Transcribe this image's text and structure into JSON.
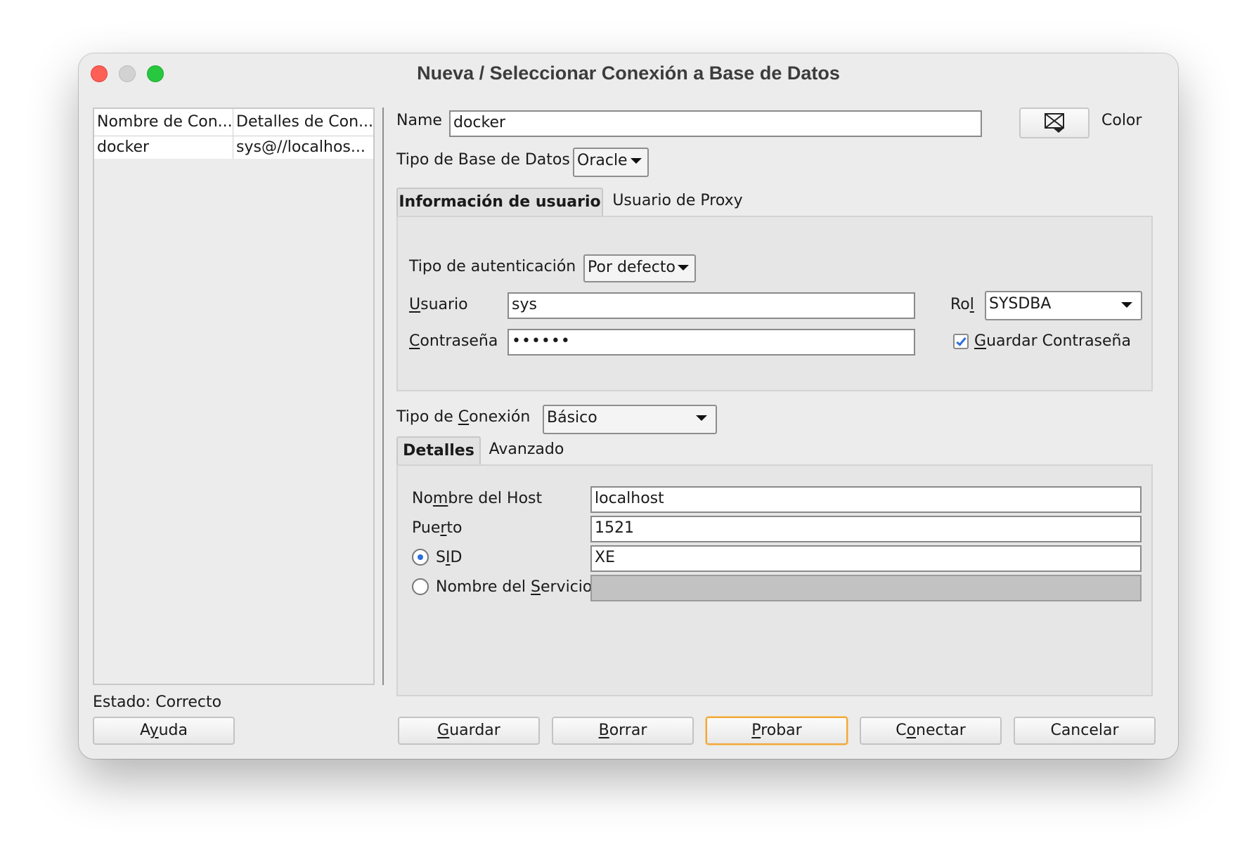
{
  "window": {
    "title": "Nueva / Seleccionar Conexión a Base de Datos"
  },
  "connection_list": {
    "columns": [
      "Nombre de Con...",
      "Detalles de Con..."
    ],
    "rows": [
      {
        "name": "docker",
        "details": "sys@//localhos..."
      }
    ]
  },
  "status_text": "Estado: Correcto",
  "form": {
    "name_label": "Name",
    "name_value": "docker",
    "color_label": "Color",
    "db_type_label": "Tipo de Base de Datos",
    "db_type_value": "Oracle",
    "tabs": [
      "Información de usuario",
      "Usuario de Proxy"
    ],
    "auth_type_label": "Tipo de autenticación",
    "auth_type_value": "Por defecto",
    "user_label_first": "U",
    "user_label_rest": "suario",
    "user_value": "sys",
    "role_label_first": "Ro",
    "role_label_ul": "l",
    "role_value": "SYSDBA",
    "password_label_first": "C",
    "password_label_rest": "ontraseña",
    "password_value": "••••••",
    "save_password_first": "G",
    "save_password_rest": "uardar Contraseña",
    "save_password_checked": true,
    "conn_type_label_pre": "Tipo de ",
    "conn_type_label_ul": "C",
    "conn_type_label_post": "onexión",
    "conn_type_value": "Básico",
    "detail_tabs": [
      "Detalles",
      "Avanzado"
    ],
    "host_label_pre": "No",
    "host_label_ul": "m",
    "host_label_post": "bre del Host",
    "host_value": "localhost",
    "port_label_pre": "Pue",
    "port_label_ul": "r",
    "port_label_post": "to",
    "port_value": "1521",
    "sid_label_pre": "S",
    "sid_label_ul": "I",
    "sid_label_post": "D",
    "sid_value": "XE",
    "sid_selected": true,
    "service_label_pre": "Nombre del ",
    "service_label_ul": "S",
    "service_label_post": "ervicio",
    "service_value": ""
  },
  "buttons": {
    "help_pre": "A",
    "help_ul": "y",
    "help_post": "uda",
    "save_ul": "G",
    "save_post": "uardar",
    "delete_ul": "B",
    "delete_post": "orrar",
    "test_ul": "P",
    "test_post": "robar",
    "connect_pre": "C",
    "connect_ul": "o",
    "connect_post": "nectar",
    "cancel": "Cancelar"
  },
  "colors": {
    "accent": "#2a6fdb",
    "focus_ring": "#f0a73a"
  }
}
